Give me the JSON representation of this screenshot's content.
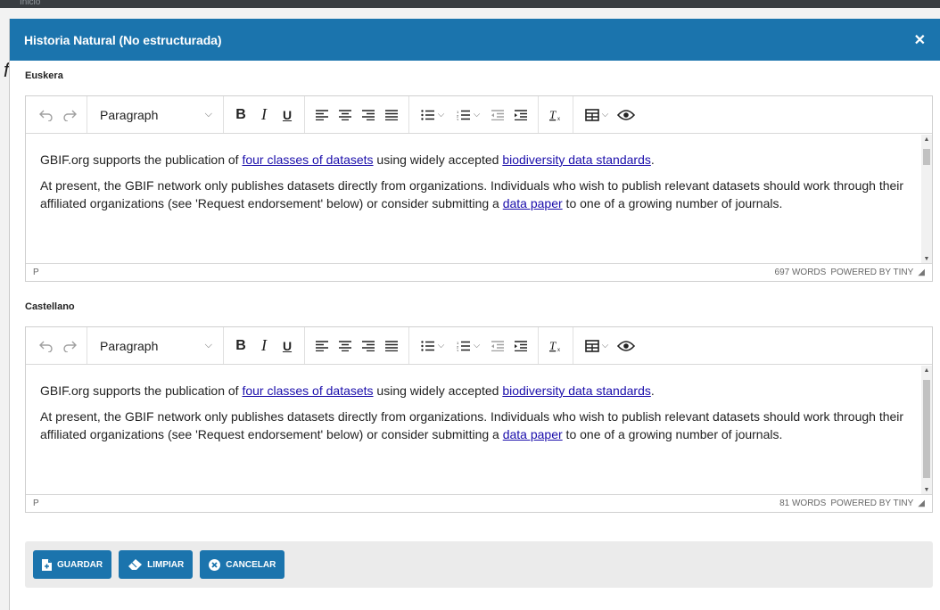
{
  "background": {
    "breadcrumb": "Inicio",
    "partial_glyph": "f"
  },
  "modal": {
    "title": "Historia Natural (No estructurada)",
    "close_icon": "close-icon",
    "header_color": "#1b74ad"
  },
  "editors": [
    {
      "language_label": "Euskera",
      "toolbar": {
        "format_select": "Paragraph"
      },
      "content": {
        "p1_before": "GBIF.org supports the publication of ",
        "p1_link1": "four classes of datasets",
        "p1_middle": " using widely accepted ",
        "p1_link2": "biodiversity data standards",
        "p1_after": ".",
        "p2_before": "At present, the GBIF network only publishes datasets directly from organizations. Individuals who wish to publish relevant datasets should work through their affiliated organizations (see 'Request endorsement' below) or consider submitting a ",
        "p2_link": "data paper",
        "p2_after": " to one of a growing number of journals."
      },
      "status": {
        "path": "P",
        "word_count": "697 WORDS",
        "powered_by": "POWERED BY TINY"
      }
    },
    {
      "language_label": "Castellano",
      "toolbar": {
        "format_select": "Paragraph"
      },
      "content": {
        "p1_before": "GBIF.org supports the publication of ",
        "p1_link1": "four classes of datasets",
        "p1_middle": " using widely accepted ",
        "p1_link2": "biodiversity data standards",
        "p1_after": ".",
        "p2_before": "At present, the GBIF network only publishes datasets directly from organizations. Individuals who wish to publish relevant datasets should work through their affiliated organizations (see 'Request endorsement' below) or consider submitting a ",
        "p2_link": "data paper",
        "p2_after": " to one of a growing number of journals."
      },
      "status": {
        "path": "P",
        "word_count": "81 WORDS",
        "powered_by": "POWERED BY TINY"
      }
    }
  ],
  "footer": {
    "save_label": "GUARDAR",
    "clear_label": "LIMPIAR",
    "cancel_label": "CANCELAR",
    "button_color": "#1b74ad"
  }
}
